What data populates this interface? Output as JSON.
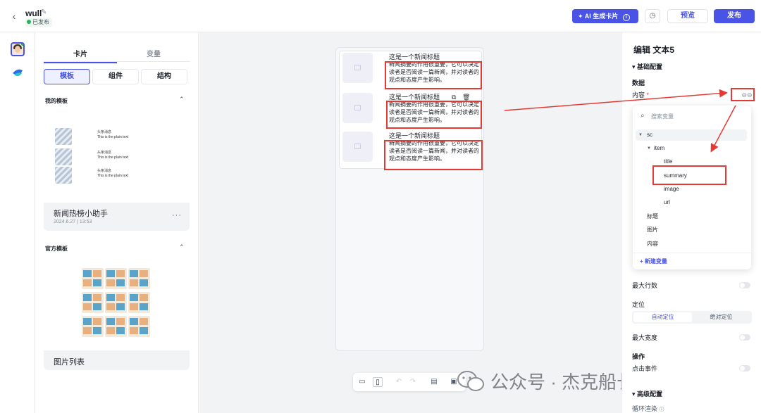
{
  "header": {
    "project_name": "wull",
    "status": "已发布",
    "ai_button": "AI 生成卡片",
    "preview_button": "预览",
    "publish_button": "发布"
  },
  "left_panel": {
    "tabs": [
      "卡片",
      "变量"
    ],
    "segments": [
      "模板",
      "组件",
      "结构"
    ],
    "my_templates_title": "我的模板",
    "my_template": {
      "name": "新闻热榜小助手",
      "date": "2024.6.27 | 13:53",
      "mini_title": "头条消息",
      "mini_text": "This is the plain text"
    },
    "official_templates_title": "官方模板",
    "official_template": {
      "name": "图片列表"
    }
  },
  "canvas": {
    "news_title": "这是一个新闻标题",
    "news_summary": "新闻摘要的作用很重要，它可以决定读者是否阅读一篇新闻，并对读者的观点和态度产生影响。"
  },
  "watermark": "公众号 · 杰克船长的AIGC",
  "right_panel": {
    "title": "编辑 文本5",
    "basic_config": "基础配置",
    "data_section": "数据",
    "content_label": "内容",
    "max_lines": "最大行数",
    "position_label": "定位",
    "position_options": [
      "自动定位",
      "绝对定位"
    ],
    "max_width": "最大宽度",
    "actions_section": "操作",
    "click_event": "点击事件",
    "advanced_config": "高级配置",
    "loop_render": "循环渲染"
  },
  "variable_dropdown": {
    "search_placeholder": "搜索变量",
    "root": "sc",
    "item": "item",
    "fields": [
      "title",
      "summary",
      "image",
      "url"
    ],
    "others": [
      "标题",
      "图片",
      "内容"
    ],
    "new_variable": "+ 新建变量"
  },
  "colors": {
    "accent": "#4954e6",
    "annotation": "#e53935",
    "published": "#22b45e"
  }
}
